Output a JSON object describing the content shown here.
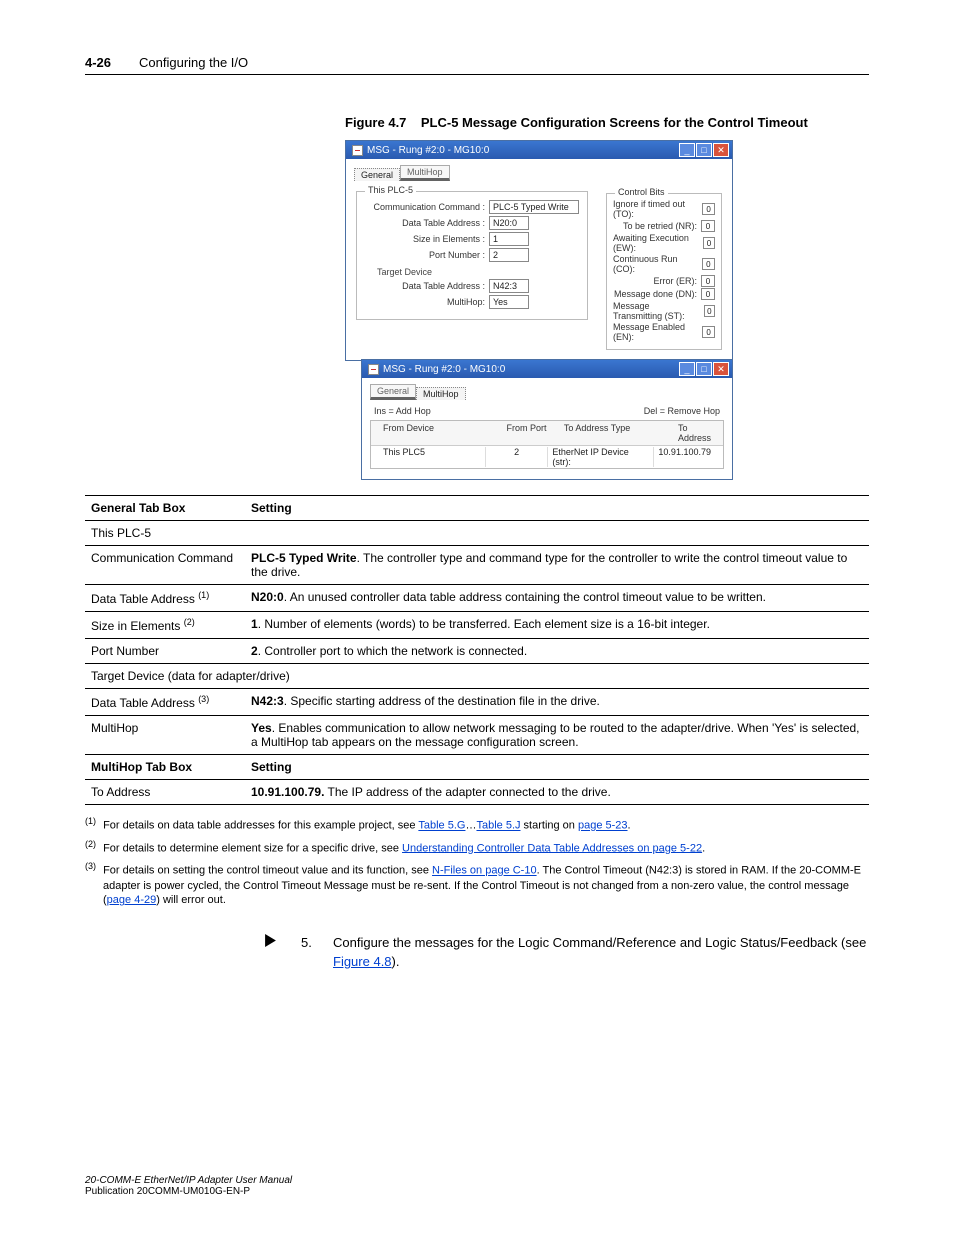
{
  "header": {
    "page_num": "4-26",
    "chapter": "Configuring the I/O"
  },
  "figure": {
    "label": "Figure 4.7",
    "caption": "PLC-5 Message Configuration Screens for the Control Timeout"
  },
  "win1": {
    "title": "MSG - Rung #2:0 - MG10:0",
    "tabs": {
      "general": "General",
      "multihop": "MultiHop"
    },
    "group_this": "This PLC-5",
    "comm_cmd_lbl": "Communication Command :",
    "comm_cmd_val": "PLC-5 Typed Write",
    "dta_lbl": "Data Table Address :",
    "dta_val": "N20:0",
    "size_lbl": "Size in Elements :",
    "size_val": "1",
    "port_lbl": "Port Number :",
    "port_val": "2",
    "group_target": "Target Device",
    "tgt_dta_val": "N42:3",
    "mh_lbl": "MultiHop:",
    "mh_val": "Yes",
    "ctrl_bits_title": "Control Bits",
    "bits": [
      {
        "lbl": "Ignore if timed out (TO):",
        "v": "0"
      },
      {
        "lbl": "To be retried (NR):",
        "v": "0"
      },
      {
        "lbl": "Awaiting Execution (EW):",
        "v": "0"
      },
      {
        "lbl": "Continuous Run (CO):",
        "v": "0"
      },
      {
        "lbl": "Error (ER):",
        "v": "0"
      },
      {
        "lbl": "Message done (DN):",
        "v": "0"
      },
      {
        "lbl": "Message Transmitting (ST):",
        "v": "0"
      },
      {
        "lbl": "Message Enabled (EN):",
        "v": "0"
      }
    ]
  },
  "win2": {
    "title": "MSG - Rung #2:0 - MG10:0",
    "tabs": {
      "general": "General",
      "multihop": "MultiHop"
    },
    "ins_lbl": "Ins = Add Hop",
    "del_lbl": "Del = Remove Hop",
    "headers": {
      "a": "From Device",
      "b": "From Port",
      "c": "To Address Type",
      "d": "To Address"
    },
    "row": {
      "a": "This PLC5",
      "b": "2",
      "c": "EtherNet IP Device (str):",
      "d": "10.91.100.79"
    }
  },
  "table": {
    "h1": "General Tab Box",
    "h2": "Setting",
    "r_thisplc": "This PLC-5",
    "r_comm_l": "Communication Command",
    "r_comm_bold": "PLC-5 Typed Write",
    "r_comm_rest": ". The controller type and command type for the controller to write the control timeout value to the drive.",
    "r_dta_l": "Data Table Address ",
    "r_dta_bold": "N20:0",
    "r_dta_rest": ". An unused controller data table address containing the control timeout value to be written.",
    "r_size_l": "Size in Elements ",
    "r_size_bold": "1",
    "r_size_rest": ". Number of elements (words) to be transferred. Each element size is a 16-bit integer.",
    "r_port_l": "Port Number",
    "r_port_bold": "2",
    "r_port_rest": ". Controller port to which the network is connected.",
    "r_target": "Target Device (data for adapter/drive)",
    "r_tgtdta_l": "Data Table Address ",
    "r_tgtdta_bold": "N42:3",
    "r_tgtdta_rest": ". Specific starting address of the destination file in the drive.",
    "r_mh_l": "MultiHop",
    "r_mh_bold": "Yes",
    "r_mh_rest": ". Enables communication to allow network messaging to be routed to the adapter/drive. When 'Yes' is selected, a MultiHop tab appears on the message configuration screen.",
    "h3": "MultiHop Tab Box",
    "h4": "Setting",
    "r_addr_l": "To Address",
    "r_addr_bold": "10.91.100.79.",
    "r_addr_rest": " The IP address of the adapter connected to the drive."
  },
  "footnotes": {
    "f1_pre": "For details on data table addresses for this example project, see ",
    "f1_l1": "Table 5.G",
    "f1_dots": "…",
    "f1_l2": "Table 5.J",
    "f1_mid": " starting on ",
    "f1_l3": "page 5-23",
    "f1_end": ".",
    "f2_pre": "For details to determine element size for a specific drive, see ",
    "f2_l1": "Understanding Controller Data Table Addresses on page 5-22",
    "f2_end": ".",
    "f3_pre": "For details on setting the control timeout value and its function, see ",
    "f3_l1": "N-Files on page C-10",
    "f3_mid": ". The Control Timeout (N42:3) is stored in RAM. If the 20-COMM-E adapter is power cycled, the Control Timeout Message must be re-sent. If the Control Timeout is not changed from a non-zero value, the control message (",
    "f3_l2": "page 4-29",
    "f3_end": ") will error out."
  },
  "step": {
    "num": "5.",
    "text_pre": "Configure the messages for the Logic Command/Reference and Logic Status/Feedback (see ",
    "text_link": "Figure 4.8",
    "text_post": ")."
  },
  "footer": {
    "line1": "20-COMM-E EtherNet/IP Adapter User Manual",
    "line2": "Publication 20COMM-UM010G-EN-P"
  },
  "sup": {
    "one": "(1)",
    "two": "(2)",
    "three": "(3)"
  }
}
